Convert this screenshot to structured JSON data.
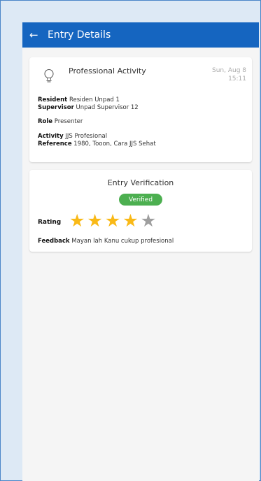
{
  "appbar": {
    "back_icon": "arrow-left-icon",
    "title": "Entry Details"
  },
  "entry": {
    "icon": "lightbulb-icon",
    "title": "Professional Activity",
    "date": "Sun, Aug 8",
    "time": "15:11",
    "fields": {
      "resident_label": "Resident",
      "resident": "Residen Unpad 1",
      "supervisor_label": "Supervisor",
      "supervisor": "Unpad Supervisor 12",
      "role_label": "Role",
      "role": "Presenter",
      "activity_label": "Activity",
      "activity": "JJS Profesional",
      "reference_label": "Reference",
      "reference": "1980, Tooon, Cara JJS Sehat"
    }
  },
  "verification": {
    "title": "Entry Verification",
    "status": "Verified",
    "status_color": "#4caf50",
    "rating_label": "Rating",
    "rating_value": 4,
    "rating_max": 5,
    "star_icon": "star-icon",
    "feedback_label": "Feedback",
    "feedback": "Mayan lah Kanu cukup profesional"
  },
  "colors": {
    "appbar": "#1565c0",
    "star_on": "#f9b917",
    "star_off": "#9e9e9e"
  }
}
